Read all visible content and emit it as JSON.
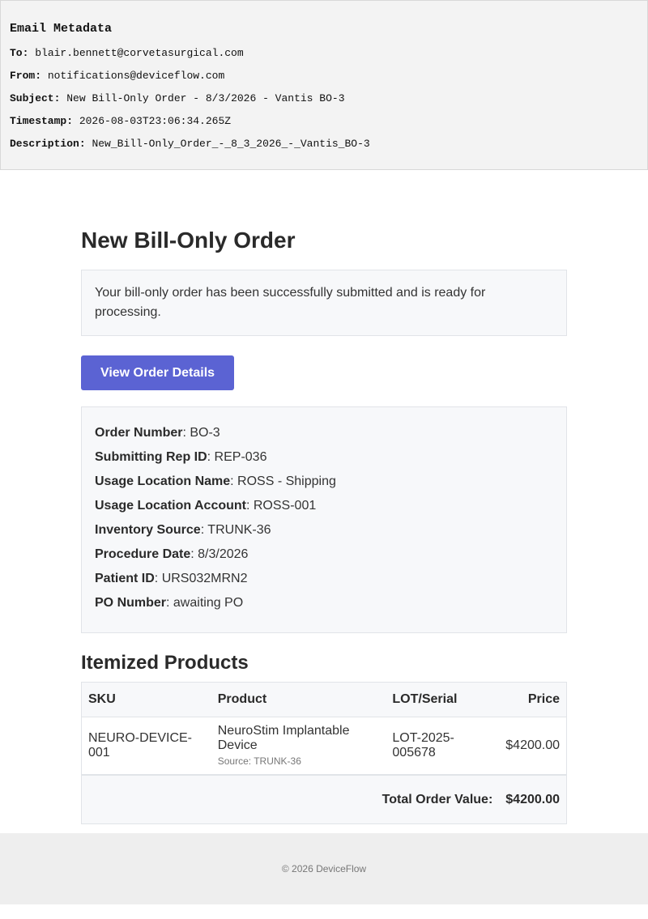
{
  "metadata": {
    "title": "Email Metadata",
    "rows": [
      {
        "key": "To:",
        "value": "blair.bennett@corvetasurgical.com"
      },
      {
        "key": "From:",
        "value": "notifications@deviceflow.com"
      },
      {
        "key": "Subject:",
        "value": "New Bill-Only Order - 8/3/2026 - Vantis BO-3"
      },
      {
        "key": "Timestamp:",
        "value": "2026-08-03T23:06:34.265Z"
      },
      {
        "key": "Description:",
        "value": "New_Bill-Only_Order_-_8_3_2026_-_Vantis_BO-3"
      }
    ]
  },
  "email": {
    "title": "New Bill-Only Order",
    "notice": "Your bill-only order has been successfully submitted and is ready for processing.",
    "button_label": "View Order Details",
    "details": [
      {
        "key": "Order Number",
        "value": ": BO-3"
      },
      {
        "key": "Submitting Rep ID",
        "value": ": REP-036"
      },
      {
        "key": "Usage Location Name",
        "value": ": ROSS - Shipping"
      },
      {
        "key": "Usage Location Account",
        "value": ": ROSS-001"
      },
      {
        "key": "Inventory Source",
        "value": ": TRUNK-36"
      },
      {
        "key": "Procedure Date",
        "value": ": 8/3/2026"
      },
      {
        "key": "Patient ID",
        "value": ": URS032MRN2"
      },
      {
        "key": "PO Number",
        "value": ": awaiting PO"
      }
    ],
    "products_title": "Itemized Products",
    "table": {
      "headers": {
        "sku": "SKU",
        "product": "Product",
        "lot": "LOT/Serial",
        "price": "Price"
      },
      "rows": [
        {
          "sku": "NEURO-DEVICE-001",
          "product": "NeuroStim Implantable Device",
          "source": "Source: TRUNK-36",
          "lot": "LOT-2025-005678",
          "price": "$4200.00"
        }
      ],
      "total_label": "Total Order Value:",
      "total_value": "$4200.00"
    },
    "footer": "© 2026 DeviceFlow"
  }
}
